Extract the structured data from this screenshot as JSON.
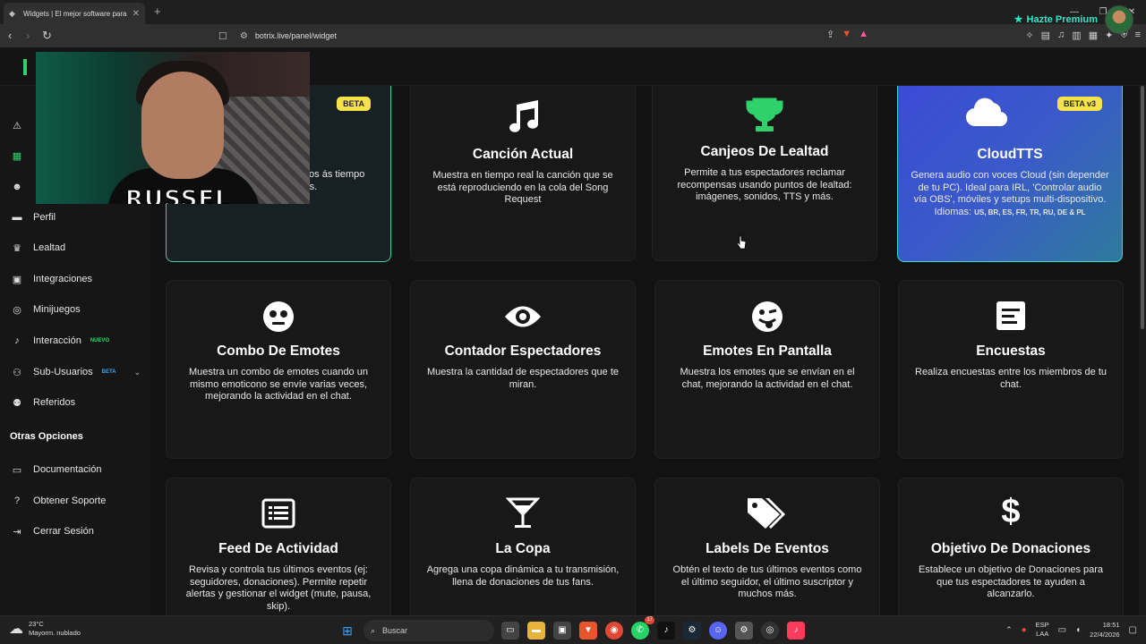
{
  "browser": {
    "tab_title": "Widgets | El mejor software para",
    "url": "botrix.live/panel/widget"
  },
  "header": {
    "premium_label": "Hazte Premium"
  },
  "sidebar": {
    "items": [
      {
        "label": "Perfil",
        "icon": "user-card-icon"
      },
      {
        "label": "Lealtad",
        "icon": "trophy-icon"
      },
      {
        "label": "Integraciones",
        "icon": "integrations-icon"
      },
      {
        "label": "Minijuegos",
        "icon": "gamepad-icon"
      },
      {
        "label": "Interacción",
        "icon": "music-icon",
        "badge": "NUEVO"
      },
      {
        "label": "Sub-Usuarios",
        "icon": "users-icon",
        "badge": "BETA"
      },
      {
        "label": "Referidos",
        "icon": "referral-icon"
      }
    ],
    "section_title": "Otras Opciones",
    "other_items": [
      {
        "label": "Documentación",
        "icon": "doc-icon"
      },
      {
        "label": "Obtener Soporte",
        "icon": "help-icon"
      },
      {
        "label": "Cerrar Sesión",
        "icon": "logout-icon"
      }
    ]
  },
  "webcam": {
    "name_overlay": "RUSSEL"
  },
  "cards": [
    {
      "title": "",
      "badge": "BETA",
      "desc": "para dar un momentos ás tiempo generar los mensajes.",
      "icon": "ai-icon"
    },
    {
      "title": "Canción Actual",
      "desc": "Muestra en tiempo real la canción que se está reproduciendo en la cola del Song Request",
      "icon": "music-note-icon"
    },
    {
      "title": "Canjeos De Lealtad",
      "desc": "Permite a tus espectadores reclamar recompensas usando puntos de lealtad: imágenes, sonidos, TTS y más.",
      "icon": "trophy-icon"
    },
    {
      "title": "CloudTTS",
      "badge": "BETA v3",
      "desc": "Genera audio con voces Cloud (sin depender de tu PC). Ideal para IRL, 'Controlar audio vía OBS', móviles y setups multi-dispositivo. Idiomas:",
      "langs": "US, BR, ES, FR, TR, RU, DE & PL",
      "icon": "cloud-icon"
    },
    {
      "title": "Combo De Emotes",
      "desc": "Muestra un combo de emotes cuando un mismo emoticono se envíe varias veces, mejorando la actividad en el chat.",
      "icon": "face-icon"
    },
    {
      "title": "Contador Espectadores",
      "desc": "Muestra la cantidad de espectadores que te miran.",
      "icon": "eye-icon"
    },
    {
      "title": "Emotes En Pantalla",
      "desc": "Muestra los emotes que se envían en el chat, mejorando la actividad en el chat.",
      "icon": "tongue-face-icon"
    },
    {
      "title": "Encuestas",
      "desc": "Realiza encuestas entre los miembros de tu chat.",
      "icon": "poll-icon"
    },
    {
      "title": "Feed De Actividad",
      "desc": "Revisa y controla tus últimos eventos (ej: seguidores, donaciones). Permite repetir alertas y gestionar el widget (mute, pausa, skip).",
      "icon": "list-icon"
    },
    {
      "title": "La Copa",
      "desc": "Agrega una copa dinámica a tu transmisión, llena de donaciones de tus fans.",
      "icon": "cocktail-icon"
    },
    {
      "title": "Labels De Eventos",
      "desc": "Obtén el texto de tus últimos eventos como el último seguidor, el último suscriptor y muchos más.",
      "icon": "tags-icon"
    },
    {
      "title": "Objetivo De Donaciones",
      "desc": "Establece un objetivo de Donaciones para que tus espectadores te ayuden a alcanzarlo.",
      "icon": "dollar-icon"
    }
  ],
  "taskbar": {
    "temp": "23°C",
    "weather": "Mayorm. nublado",
    "search_placeholder": "Buscar",
    "lang1": "ESP",
    "lang2": "LAA",
    "time": "18:51",
    "date": "22/4/2026",
    "notif_count": "17"
  },
  "colors": {
    "accent_green": "#2fd16b",
    "accent_teal": "#2ee6c6",
    "beta_yellow": "#f6e34a",
    "nuevo_green": "#2fd16b",
    "beta_blue": "#3ba4f0"
  }
}
